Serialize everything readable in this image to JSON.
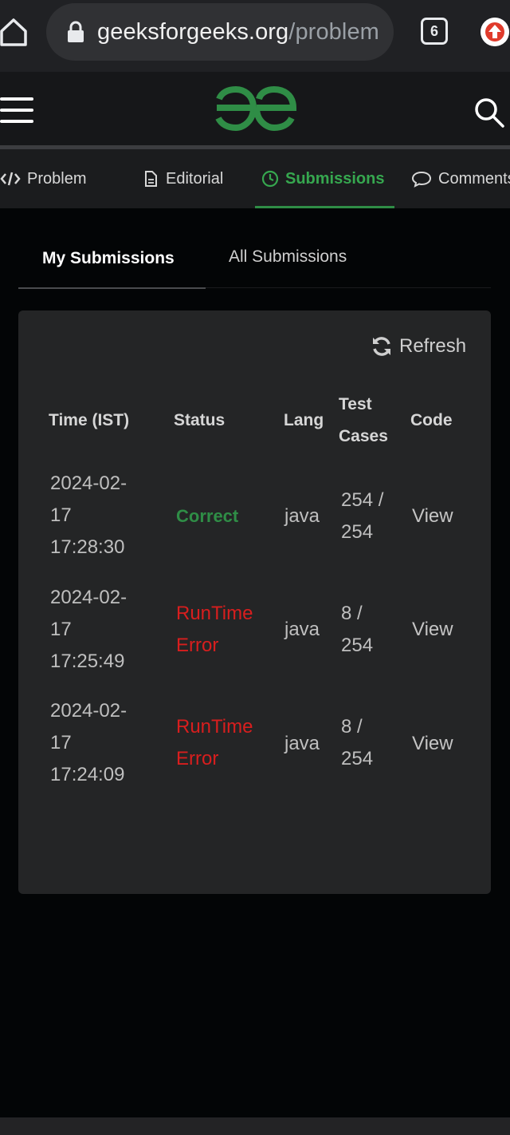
{
  "browser": {
    "url_host": "geeksforgeeks.org",
    "url_path": "/problem",
    "tab_count": "6"
  },
  "problem_tabs": [
    {
      "label": "Problem",
      "icon": "code-icon",
      "active": false
    },
    {
      "label": "Editorial",
      "icon": "document-icon",
      "active": false
    },
    {
      "label": "Submissions",
      "icon": "clock-icon",
      "active": true
    },
    {
      "label": "Comments",
      "icon": "comment-icon",
      "active": false
    }
  ],
  "submission_tabs": {
    "mine": "My Submissions",
    "all": "All Submissions"
  },
  "refresh_label": "Refresh",
  "table": {
    "headers": [
      "Time (IST)",
      "Status",
      "Lang",
      "Test Cases",
      "Code"
    ],
    "rows": [
      {
        "time": "2024-02-17 17:28:30",
        "status": "Correct",
        "status_type": "correct",
        "lang": "java",
        "test_cases": "254 / 254",
        "code": "View"
      },
      {
        "time": "2024-02-17 17:25:49",
        "status": "RunTime Error",
        "status_type": "error",
        "lang": "java",
        "test_cases": "8 / 254",
        "code": "View"
      },
      {
        "time": "2024-02-17 17:24:09",
        "status": "RunTime Error",
        "status_type": "error",
        "lang": "java",
        "test_cases": "8 / 254",
        "code": "View"
      }
    ]
  },
  "colors": {
    "accent_green": "#2f8d46",
    "error_red": "#d81e1e",
    "page_background": "#030506",
    "card_background": "#242526"
  }
}
